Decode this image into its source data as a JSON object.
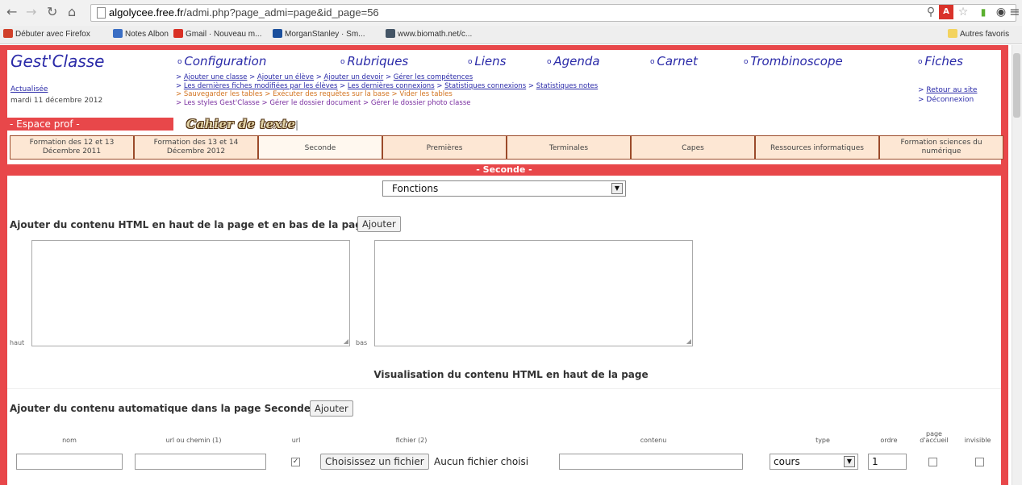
{
  "browser": {
    "url_host": "algolycee.free.fr",
    "url_path": "/admi.php?page_admi=page&id_page=56",
    "bookmarks": [
      {
        "label": "Débuter avec Firefox",
        "color": "#d0402a"
      },
      {
        "label": "Notes Albon",
        "color": "#3a6ec4"
      },
      {
        "label": "Gmail · Nouveau m...",
        "color": "#d93025"
      },
      {
        "label": "MorganStanley · Sm...",
        "color": "#1b4f9c"
      },
      {
        "label": "www.biomath.net/c...",
        "color": "#445566"
      }
    ],
    "other_bookmarks": "Autres favoris"
  },
  "header": {
    "logo": "Gest'Classe",
    "menu": [
      "Configuration",
      "Rubriques",
      "Liens",
      "Agenda",
      "Carnet",
      "Trombinoscope",
      "Fiches"
    ],
    "update_link": "Actualisée",
    "update_date": "mardi 11 décembre 2012",
    "sublinks": {
      "line1": [
        "Ajouter une classe",
        "Ajouter un élève",
        "Ajouter un devoir",
        "Gérer les compétences"
      ],
      "line2": [
        "Les dernières fiches modifiées par les élèves",
        "Les dernières connexions",
        "Statistiques connexions",
        "Statistiques notes"
      ],
      "line3": [
        "Sauvegarder les tables",
        "Exécuter des requêtes sur la base",
        "Vider les tables"
      ],
      "line4": [
        "Les styles Gest'Classe",
        "Gérer le dossier document",
        "Gérer le dossier photo classe"
      ]
    },
    "right_links": [
      "Retour au site",
      "Déconnexion"
    ],
    "espace": "- Espace prof -",
    "cahier": "Cahier de texte",
    "cahier_sep": "|"
  },
  "tabs": [
    "Formation des 12 et 13 Décembre 2011",
    "Formation des 13 et 14 Décembre 2012",
    "Seconde",
    "Premières",
    "Terminales",
    "Capes",
    "Ressources informatiques",
    "Formation sciences du numérique"
  ],
  "section_title": "- Seconde -",
  "content": {
    "select_value": "Fonctions",
    "html_heading": "Ajouter du contenu HTML en haut de la page et en bas de la page",
    "add_button": "Ajouter",
    "label_haut": "haut",
    "label_bas": "bas",
    "preview_heading": "Visualisation du contenu HTML en haut de la page",
    "auto_heading": "Ajouter du contenu automatique dans la page Seconde :",
    "auto_button": "Ajouter",
    "columns": [
      "nom",
      "url ou chemin (1)",
      "url",
      "fichier (2)",
      "contenu",
      "type",
      "ordre",
      "page d'accueil",
      "invisible"
    ],
    "file_button": "Choisissez un fichier",
    "file_status": "Aucun fichier choisi",
    "type_value": "cours",
    "ordre_value": "1"
  }
}
